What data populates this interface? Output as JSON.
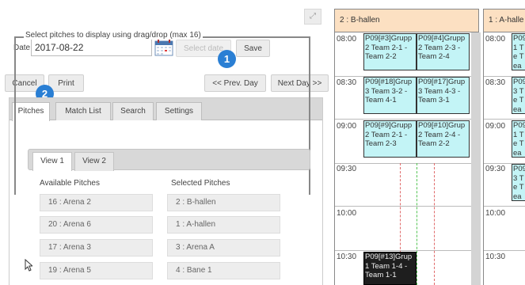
{
  "toolbar": {
    "date_label": "Date:",
    "date_value": "2017-08-22",
    "select_date_label": "Select date",
    "save_label": "Save",
    "cancel_label": "Cancel",
    "print_label": "Print",
    "prev_day_label": "<< Prev. Day",
    "next_day_label": "Next Day >>",
    "expand_icon": "⤢"
  },
  "badges": {
    "one": "1",
    "two": "2"
  },
  "tabs": [
    "Pitches",
    "Match List",
    "Search",
    "Settings"
  ],
  "pitches_panel": {
    "legend": "Select pitches to display using drag/drop (max 16)",
    "view_tabs": [
      "View 1",
      "View 2"
    ],
    "available_header": "Available Pitches",
    "selected_header": "Selected Pitches",
    "available": [
      "16 : Arena 2",
      "20 : Arena 6",
      "17 : Arena 3",
      "19 : Arena 5"
    ],
    "selected": [
      "2 : B-hallen",
      "1 : A-hallen",
      "3 : Arena A",
      "4 : Bane 1"
    ]
  },
  "schedule": {
    "columns": [
      "2 : B-hallen",
      "1 : A-halle"
    ],
    "times": [
      "08:00",
      "08:30",
      "09:00",
      "09:30",
      "10:00",
      "10:30"
    ],
    "matches_b": [
      {
        "text": "P09[#3]Grupp 2 Team 2-1 - Team 2-2"
      },
      {
        "text": "P09[#4]Grupp 2 Team 2-3 - Team 2-4"
      },
      {
        "text": "P09[#18]Grup 3 Team 3-2 - Team 4-1"
      },
      {
        "text": "P09[#17]Grup 3 Team 4-3 - Team 3-1"
      },
      {
        "text": "P09[#9]Grupp 2 Team 2-1 - Team 2-3"
      },
      {
        "text": "P09[#10]Grup 2 Team 2-4 - Team 2-2"
      },
      {
        "text": "P09[#13]Grup 1 Team 1-4 - Team 1-1"
      }
    ],
    "matches_a": [
      {
        "text": "P09 1 Te Tea"
      },
      {
        "text": "P09 3 Te Tea"
      },
      {
        "text": "P09 1 Te Tea"
      },
      {
        "text": "P09 3 Te Tea"
      }
    ]
  }
}
